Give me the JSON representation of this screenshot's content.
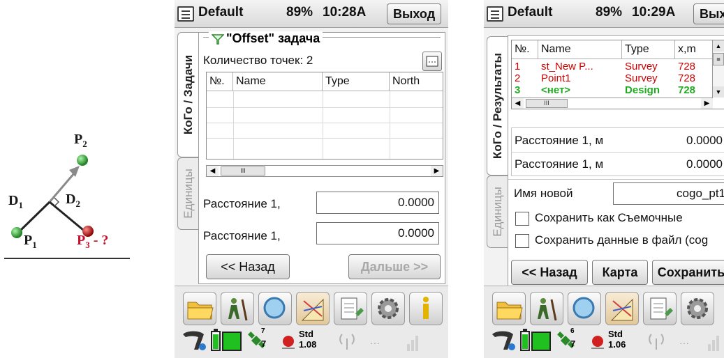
{
  "diagram": {
    "labels": {
      "p1": "P",
      "p1_sub": "1",
      "p2": "P",
      "p2_sub": "2",
      "p3": "P",
      "p3_sub": "3",
      "p3_suffix": " - ?",
      "d1": "D",
      "d1_sub": "1",
      "d2": "D",
      "d2_sub": "2"
    },
    "colors": {
      "point_green": "#2fa82f",
      "point_red": "#c8102e",
      "line": "#222222",
      "arrow": "#8a8a8a"
    }
  },
  "screen1": {
    "title": {
      "profile": "Default",
      "battery": "89%",
      "time": "10:28A",
      "exit": "Выход"
    },
    "tabs": {
      "active": "КоГо / Задачи",
      "inactive": "Единицы"
    },
    "task_title": "\"Offset\" задача",
    "points_count_label": "Количество точек: 2",
    "table": {
      "columns": [
        "№.",
        "Name",
        "Type",
        "North"
      ],
      "rows": []
    },
    "scroll_thumb": "III",
    "fields": [
      {
        "label": "Расстояние 1,",
        "value": "0.0000"
      },
      {
        "label": "Расстояние 1,",
        "value": "0.0000"
      }
    ],
    "buttons": {
      "back": "<< Назад",
      "next": "Дальше >>"
    },
    "status": {
      "sat_top": "7",
      "sat_bottom": "7",
      "std_label": "Std",
      "std_value": "1.08"
    }
  },
  "screen2": {
    "title": {
      "profile": "Default",
      "battery": "89%",
      "time": "10:29A",
      "exit": "Выход"
    },
    "tabs": {
      "active": "КоГо / Результаты",
      "inactive": "Единицы"
    },
    "table": {
      "columns": [
        "№.",
        "Name",
        "Type",
        "x,m"
      ],
      "rows": [
        {
          "no": "1",
          "name": "st_New P...",
          "type": "Survey",
          "x": "728",
          "color": "#cc0000"
        },
        {
          "no": "2",
          "name": "Point1",
          "type": "Survey",
          "x": "728",
          "color": "#cc0000"
        },
        {
          "no": "3",
          "name": "<нет>",
          "type": "Design",
          "x": "728",
          "color": "#22aa22"
        }
      ]
    },
    "scroll_thumb": "III",
    "results": [
      {
        "label": "Расстояние 1, м",
        "value": "0.0000"
      },
      {
        "label": "Расстояние 1, м",
        "value": "0.0000"
      }
    ],
    "new_name": {
      "label": "Имя новой",
      "value": "cogo_pt1"
    },
    "checkboxes": [
      {
        "label": "Сохранить как Съемочные",
        "checked": false
      },
      {
        "label": "Сохранить данные в файл (cog",
        "checked": false
      }
    ],
    "buttons": {
      "back": "<< Назад",
      "map": "Карта",
      "save": "Сохранить"
    },
    "status": {
      "sat_top": "6",
      "sat_bottom": "7",
      "std_label": "Std",
      "std_value": "1.06"
    }
  }
}
